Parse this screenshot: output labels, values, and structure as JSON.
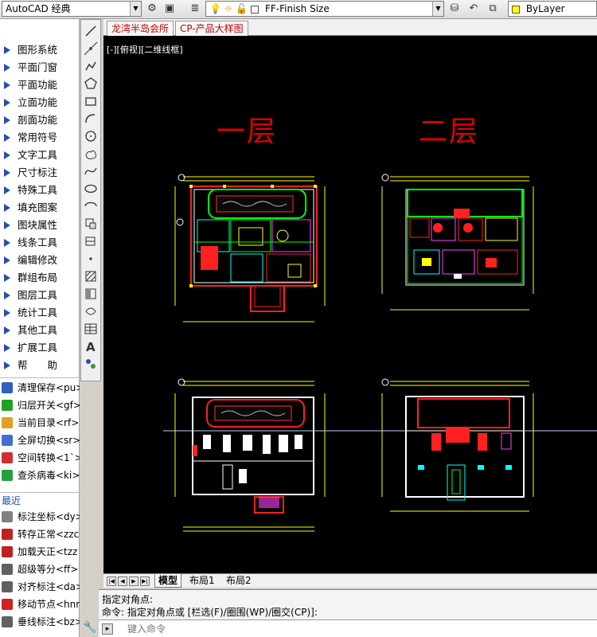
{
  "toolbar": {
    "workspace": "AutoCAD 经典",
    "layer_name": "FF-Finish Size",
    "color": "ByLayer",
    "layer_color": "#ffff00"
  },
  "left_menu": [
    {
      "label": "图形系统"
    },
    {
      "label": "平面门窗"
    },
    {
      "label": "平面功能"
    },
    {
      "label": "立面功能"
    },
    {
      "label": "剖面功能"
    },
    {
      "label": "常用符号"
    },
    {
      "label": "文字工具"
    },
    {
      "label": "尺寸标注"
    },
    {
      "label": "特殊工具"
    },
    {
      "label": "填充图案"
    },
    {
      "label": "图块属性"
    },
    {
      "label": "线条工具"
    },
    {
      "label": "编辑修改"
    },
    {
      "label": "群组布局"
    },
    {
      "label": "图层工具"
    },
    {
      "label": "统计工具"
    },
    {
      "label": "其他工具"
    },
    {
      "label": "扩展工具"
    },
    {
      "label": "帮　　助"
    }
  ],
  "commands": [
    {
      "label": "清理保存<pu>",
      "color": "#3060c0"
    },
    {
      "label": "归层开关<gf>",
      "color": "#20a020"
    },
    {
      "label": "当前目录<rf>",
      "color": "#e0a020"
    },
    {
      "label": "全屏切换<sr>",
      "color": "#4070d0"
    },
    {
      "label": "空间转换<1`>",
      "color": "#d03030"
    },
    {
      "label": "查杀病毒<ki>",
      "color": "#20a040"
    }
  ],
  "recent_header": "最近",
  "recent_commands": [
    {
      "label": "标注坐标<dy>",
      "color": "#808080"
    },
    {
      "label": "转存正常<zzc",
      "color": "#c02020"
    },
    {
      "label": "加载天正<tzz",
      "color": "#c02020"
    },
    {
      "label": "超级等分<ff>",
      "color": "#606060"
    },
    {
      "label": "对齐标注<da>",
      "color": "#606060"
    },
    {
      "label": "移动节点<hnn",
      "color": "#d02020"
    },
    {
      "label": "垂线标注<bz>",
      "color": "#606060"
    }
  ],
  "file_tabs": [
    "龙湾半岛会所",
    "CP-产品大样图"
  ],
  "viewport_label": "[-][俯视][二维线框]",
  "floor_titles": {
    "first": "一层",
    "second": "二层"
  },
  "layout_tabs": [
    "模型",
    "布局1",
    "布局2"
  ],
  "command_history": [
    "指定对角点:",
    "命令: 指定对角点或 [栏选(F)/圈围(WP)/圈交(CP)]:"
  ],
  "command_placeholder": "键入命令"
}
